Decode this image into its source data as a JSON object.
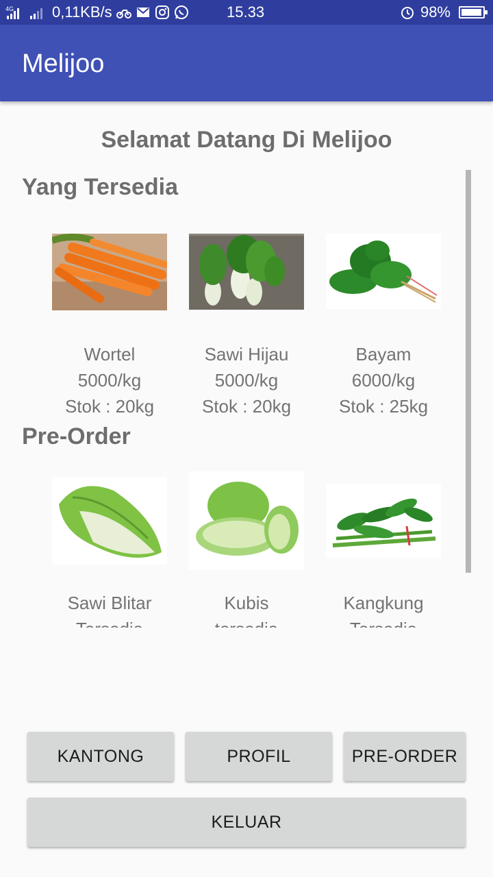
{
  "status_bar": {
    "network_type": "4G",
    "speed": "0,11KB/s",
    "time": "15.33",
    "battery": "98%",
    "battery_level": 0.98
  },
  "app_bar": {
    "title": "Melijoo"
  },
  "welcome": "Selamat Datang Di Melijoo",
  "available": {
    "title": "Yang Tersedia",
    "items": [
      {
        "name": "Wortel",
        "price": "5000/kg",
        "stock": "Stok : 20kg",
        "image": "carrot-image"
      },
      {
        "name": "Sawi Hijau",
        "price": "5000/kg",
        "stock": "Stok : 20kg",
        "image": "bok-choy-image"
      },
      {
        "name": "Bayam",
        "price": "6000/kg",
        "stock": "Stok : 25kg",
        "image": "spinach-image"
      }
    ]
  },
  "preorder": {
    "title": "Pre-Order",
    "items": [
      {
        "name": "Sawi Blitar",
        "status": "Tersedia",
        "image": "napa-cabbage-image"
      },
      {
        "name": "Kubis",
        "status": "tersedia",
        "image": "cabbage-image"
      },
      {
        "name": "Kangkung",
        "status": "Tersedia",
        "image": "water-spinach-image"
      }
    ]
  },
  "buttons": {
    "kantong": "KANTONG",
    "profil": "PROFIL",
    "preorder": "PRE-ORDER",
    "keluar": "KELUAR"
  }
}
